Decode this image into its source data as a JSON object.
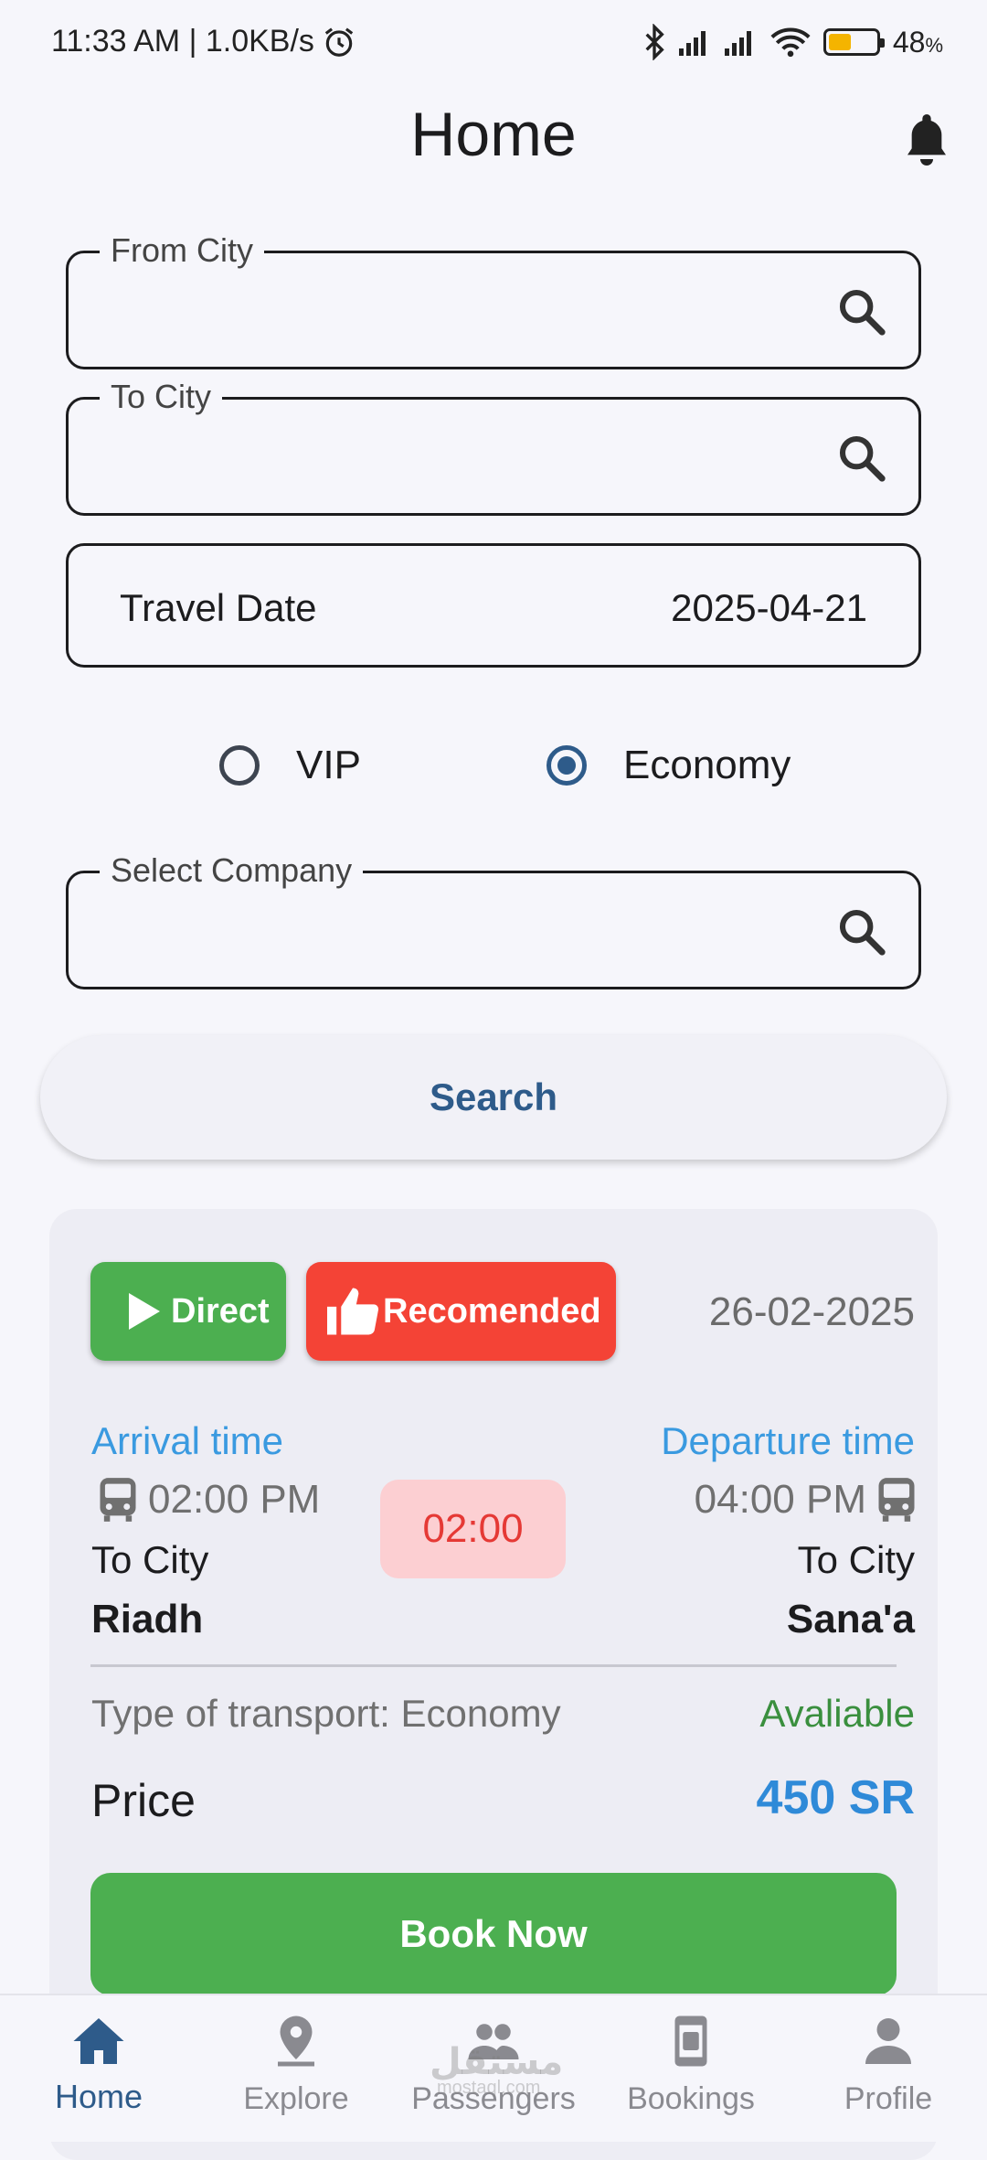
{
  "status_bar": {
    "time_speed": "11:33 AM | 1.0KB/s",
    "battery": "48",
    "battery_unit": "%",
    "battery_level": 0.48
  },
  "header": {
    "title": "Home"
  },
  "form": {
    "from_city_label": "From City",
    "from_city_value": "",
    "to_city_label": "To City",
    "to_city_value": "",
    "travel_date_label": "Travel Date",
    "travel_date_value": "2025-04-21",
    "class_options": [
      "VIP",
      "Economy"
    ],
    "class_selected": "Economy",
    "company_label": "Select Company",
    "company_value": "",
    "search_label": "Search"
  },
  "trip": {
    "tag_direct": "Direct",
    "tag_recommended": "Recomended",
    "date": "26-02-2025",
    "arrival_title": "Arrival time",
    "arrival_time": "02:00 PM",
    "arrival_city_label": "To City",
    "arrival_city": "Riadh",
    "duration": "02:00",
    "departure_title": "Departure time",
    "departure_time": "04:00 PM",
    "departure_city_label": "To City",
    "departure_city": "Sana'a",
    "transport_type": "Type of transport: Economy",
    "availability": "Avaliable",
    "price_label": "Price",
    "price_value": "450 SR",
    "book_label": "Book Now"
  },
  "bottom_nav": {
    "items": [
      {
        "label": "Home",
        "icon": "home-icon",
        "active": true
      },
      {
        "label": "Explore",
        "icon": "location-pin-icon",
        "active": false
      },
      {
        "label": "Passengers",
        "icon": "people-icon",
        "active": false
      },
      {
        "label": "Bookings",
        "icon": "ticket-phone-icon",
        "active": false
      },
      {
        "label": "Profile",
        "icon": "person-icon",
        "active": false
      }
    ]
  },
  "watermark": {
    "text": "مستقل",
    "sub": "mostaql.com"
  },
  "colors": {
    "accent": "#2e5b8a",
    "green": "#4caf50",
    "red": "#f44336",
    "blue_text": "#3a9ae0",
    "price_blue": "#2f8ad8"
  }
}
